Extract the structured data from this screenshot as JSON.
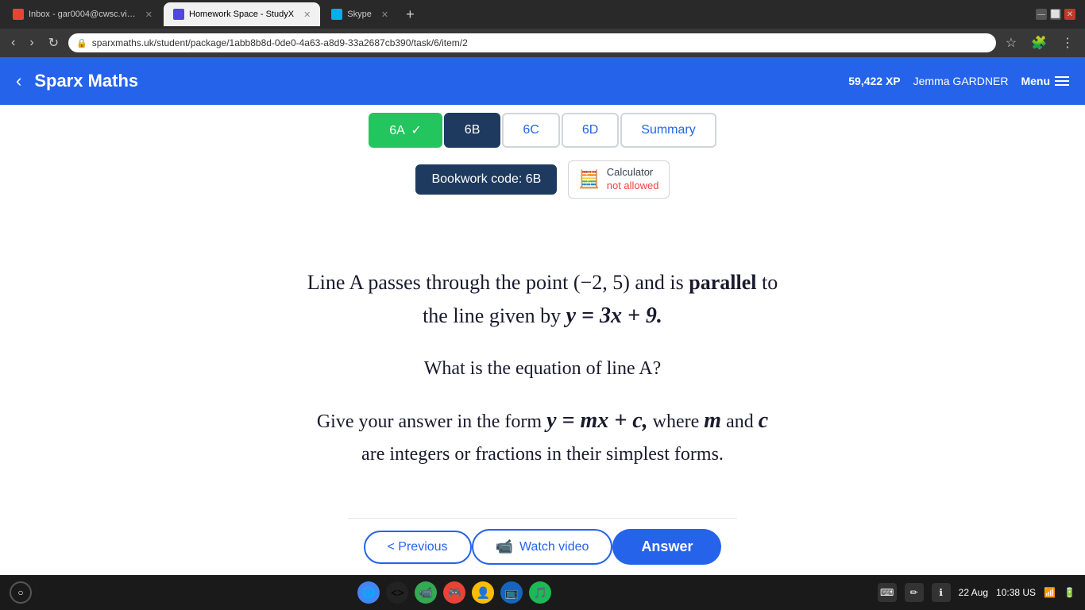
{
  "browser": {
    "tabs": [
      {
        "id": "gmail",
        "label": "Inbox - gar0004@cwsc.vic.edu",
        "active": false,
        "favicon_color": "#EA4335"
      },
      {
        "id": "studyx",
        "label": "Homework Space - StudyX",
        "active": true,
        "favicon_color": "#4F46E5"
      },
      {
        "id": "skype",
        "label": "Skype",
        "active": false,
        "favicon_color": "#00AFF0"
      }
    ],
    "url": "sparxmaths.uk/student/package/1abb8b8d-0de0-4a63-a8d9-33a2687cb390/task/6/item/2"
  },
  "header": {
    "logo": "Sparx Maths",
    "xp": "59,422 XP",
    "user": "Jemma GARDNER",
    "menu_label": "Menu"
  },
  "task_tabs": [
    {
      "id": "6A",
      "label": "6A",
      "state": "completed"
    },
    {
      "id": "6B",
      "label": "6B",
      "state": "active"
    },
    {
      "id": "6C",
      "label": "6C",
      "state": "inactive"
    },
    {
      "id": "6D",
      "label": "6D",
      "state": "inactive"
    },
    {
      "id": "summary",
      "label": "Summary",
      "state": "summary"
    }
  ],
  "bookwork": {
    "label": "Bookwork code: 6B",
    "calculator_label": "Calculator",
    "calculator_status": "not allowed"
  },
  "question": {
    "line1": "Line A passes through the point (−2, 5) and is",
    "line1_bold": "parallel",
    "line1_end": "to",
    "line2": "the line given by",
    "line2_math": "y = 3x + 9.",
    "sub": "What is the equation of line A?",
    "instruction1": "Give your answer in the form",
    "instruction_math": "y = mx + c,",
    "instruction2": "where",
    "instruction_m": "m",
    "instruction3": "and",
    "instruction_c": "c",
    "instruction4": "are integers or fractions in their simplest forms."
  },
  "buttons": {
    "previous": "< Previous",
    "watch_video": "Watch video",
    "answer": "Answer"
  },
  "taskbar": {
    "date": "22 Aug",
    "time": "10:38 US"
  }
}
